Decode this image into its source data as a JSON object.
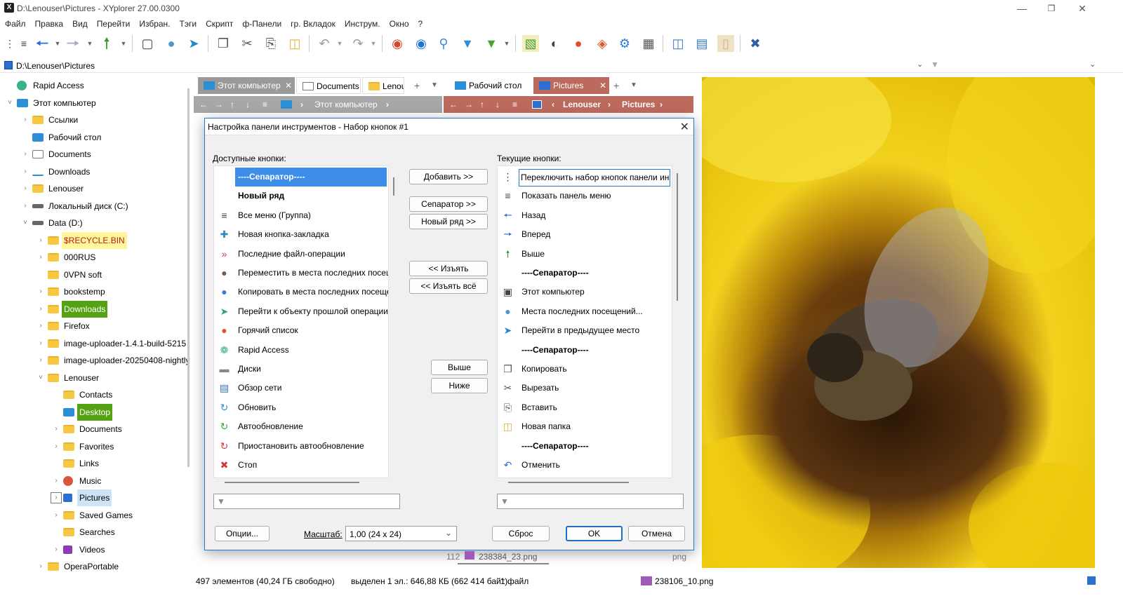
{
  "window": {
    "title": "D:\\Lenouser\\Pictures - XYplorer 27.00.0300",
    "app_icon": "X"
  },
  "menu": [
    "Файл",
    "Правка",
    "Вид",
    "Перейти",
    "Избран.",
    "Тэги",
    "Скрипт",
    "ф-Панели",
    "гр. Вкладок",
    "Инструм.",
    "Окно",
    "?"
  ],
  "address": {
    "path": "D:\\Lenouser\\Pictures"
  },
  "tree": [
    {
      "label": "Rapid Access",
      "level": 0,
      "icon": "rapid-access-icon",
      "exp": ""
    },
    {
      "label": "Этот компьютер",
      "level": 0,
      "icon": "computer-icon",
      "exp": "˅"
    },
    {
      "label": "Ссылки",
      "level": 1,
      "icon": "folder-icon",
      "exp": "›"
    },
    {
      "label": "Рабочий стол",
      "level": 1,
      "icon": "desktop-icon",
      "exp": ""
    },
    {
      "label": "Documents",
      "level": 1,
      "icon": "documents-icon",
      "exp": "›"
    },
    {
      "label": "Downloads",
      "level": 1,
      "icon": "downloads-icon",
      "exp": "›"
    },
    {
      "label": "Lenouser",
      "level": 1,
      "icon": "folder-icon",
      "exp": "›"
    },
    {
      "label": "Локальный диск (C:)",
      "level": 1,
      "icon": "drive-icon",
      "exp": "›"
    },
    {
      "label": "Data (D:)",
      "level": 1,
      "icon": "drive-icon",
      "exp": "˅"
    },
    {
      "label": "$RECYCLE.BIN",
      "level": 2,
      "icon": "folder-icon",
      "exp": "›",
      "hl": "#fff59a",
      "color": "#b81d1d"
    },
    {
      "label": "000RUS",
      "level": 2,
      "icon": "folder-icon",
      "exp": "›"
    },
    {
      "label": "0VPN soft",
      "level": 2,
      "icon": "folder-icon",
      "exp": ""
    },
    {
      "label": "bookstemp",
      "level": 2,
      "icon": "folder-icon",
      "exp": "›"
    },
    {
      "label": "Downloads",
      "level": 2,
      "icon": "folder-icon",
      "exp": "›",
      "hl": "#54a214",
      "color": "#ffffff"
    },
    {
      "label": "Firefox",
      "level": 2,
      "icon": "folder-icon",
      "exp": "›"
    },
    {
      "label": "image-uploader-1.4.1-build-5215",
      "level": 2,
      "icon": "folder-icon",
      "exp": "›"
    },
    {
      "label": "image-uploader-20250408-nightly",
      "level": 2,
      "icon": "folder-icon",
      "exp": "›"
    },
    {
      "label": "Lenouser",
      "level": 2,
      "icon": "folder-icon",
      "exp": "˅"
    },
    {
      "label": "Contacts",
      "level": 3,
      "icon": "folder-icon",
      "exp": ""
    },
    {
      "label": "Desktop",
      "level": 3,
      "icon": "desktop-icon",
      "exp": "",
      "hl": "#54a214",
      "color": "#ffffff"
    },
    {
      "label": "Documents",
      "level": 3,
      "icon": "folder-icon",
      "exp": "›"
    },
    {
      "label": "Favorites",
      "level": 3,
      "icon": "folder-icon",
      "exp": "›"
    },
    {
      "label": "Links",
      "level": 3,
      "icon": "folder-icon",
      "exp": ""
    },
    {
      "label": "Music",
      "level": 3,
      "icon": "music-icon",
      "exp": "›"
    },
    {
      "label": "Pictures",
      "level": 3,
      "icon": "pictures-icon",
      "exp": "›",
      "selected": true
    },
    {
      "label": "Saved Games",
      "level": 3,
      "icon": "folder-icon",
      "exp": "›"
    },
    {
      "label": "Searches",
      "level": 3,
      "icon": "folder-icon",
      "exp": ""
    },
    {
      "label": "Videos",
      "level": 3,
      "icon": "videos-icon",
      "exp": "›"
    },
    {
      "label": "OperaPortable",
      "level": 2,
      "icon": "folder-icon",
      "exp": "›"
    }
  ],
  "panes": {
    "left_tabs": [
      {
        "label": "Этот компьютер",
        "icon": "computer-icon",
        "active": true
      },
      {
        "label": "Documents",
        "icon": "documents-icon"
      },
      {
        "label": "Lenouser",
        "icon": "folder-icon"
      }
    ],
    "right_tabs": [
      {
        "label": "Рабочий стол",
        "icon": "desktop-icon"
      },
      {
        "label": "Pictures",
        "icon": "pictures-icon",
        "active": true
      }
    ],
    "left_crumb": "Этот компьютер",
    "right_crumb": [
      "Lenouser",
      "Pictures"
    ],
    "behind_row": {
      "index": "112",
      "file": "238384_23.png",
      "ext": "png"
    }
  },
  "dialog": {
    "title": "Настройка панели инструментов - Набор кнопок #1",
    "available_label": "Доступные кнопки:",
    "current_label": "Текущие кнопки:",
    "available": [
      {
        "label": "----Сепаратор----",
        "icon": "",
        "selected": true,
        "bold": true
      },
      {
        "label": "Новый ряд",
        "icon": "",
        "bold": true
      },
      {
        "label": "Все меню (Группа)",
        "icon": "menu-icon"
      },
      {
        "label": "Новая кнопка-закладка",
        "icon": "bookmark-button-icon"
      },
      {
        "label": "Последние файл-операции",
        "icon": "recent-ops-icon"
      },
      {
        "label": "Переместить в места последних посещений",
        "icon": "move-recent-icon"
      },
      {
        "label": "Копировать в места последних посещений",
        "icon": "copy-recent-icon"
      },
      {
        "label": "Перейти к объекту прошлой операции",
        "icon": "goto-last-op-icon"
      },
      {
        "label": "Горячий список",
        "icon": "hotlist-icon"
      },
      {
        "label": "Rapid Access",
        "icon": "rapid-access-icon"
      },
      {
        "label": "Диски",
        "icon": "drives-icon"
      },
      {
        "label": "Обзор сети",
        "icon": "network-icon"
      },
      {
        "label": "Обновить",
        "icon": "refresh-icon"
      },
      {
        "label": "Автообновление",
        "icon": "auto-refresh-icon"
      },
      {
        "label": "Приостановить автообновление",
        "icon": "pause-refresh-icon"
      },
      {
        "label": "Стоп",
        "icon": "stop-icon"
      }
    ],
    "current": [
      {
        "label": "Переключить набор кнопок панели инструментов",
        "icon": "toggle-set-icon",
        "focused": true
      },
      {
        "label": "Показать панель меню",
        "icon": "menu-icon"
      },
      {
        "label": "Назад",
        "icon": "back-arrow-icon"
      },
      {
        "label": "Вперед",
        "icon": "forward-arrow-icon"
      },
      {
        "label": "Выше",
        "icon": "up-arrow-icon"
      },
      {
        "label": "----Сепаратор----",
        "icon": "",
        "bold": true
      },
      {
        "label": "Этот компьютер",
        "icon": "computer-icon"
      },
      {
        "label": "Места последних посещений...",
        "icon": "location-pin-icon"
      },
      {
        "label": "Перейти в предыдущее место",
        "icon": "previous-location-icon"
      },
      {
        "label": "----Сепаратор----",
        "icon": "",
        "bold": true
      },
      {
        "label": "Копировать",
        "icon": "copy-icon"
      },
      {
        "label": "Вырезать",
        "icon": "cut-icon"
      },
      {
        "label": "Вставить",
        "icon": "paste-icon"
      },
      {
        "label": "Новая папка",
        "icon": "new-folder-icon"
      },
      {
        "label": "----Сепаратор----",
        "icon": "",
        "bold": true
      },
      {
        "label": "Отменить",
        "icon": "undo-icon"
      }
    ],
    "buttons": {
      "add": "Добавить >>",
      "separator": "Сепаратор >>",
      "newrow": "Новый ряд >>",
      "remove": "<< Изъять",
      "remove_all": "<< Изъять всё",
      "up": "Выше",
      "down": "Ниже",
      "options": "Опции...",
      "reset": "Сброс",
      "ok": "OK",
      "cancel": "Отмена"
    },
    "scale_label": "Масштаб:",
    "scale_value": "1,00   (24 x 24)",
    "filter_icon": "filter-icon"
  },
  "status": {
    "count": "497 элементов (40,24 ГБ свободно)",
    "selected": "выделен 1 эл.: 646,88 КБ (662 414 байт)",
    "files": "1 файл",
    "current_file": "238106_10.png"
  },
  "colors": {
    "accent": "#1f7bd6",
    "tab_active_right": "#bd6a5e",
    "crumb_left": "#a7a7a7",
    "selection": "#3d8ee8"
  }
}
